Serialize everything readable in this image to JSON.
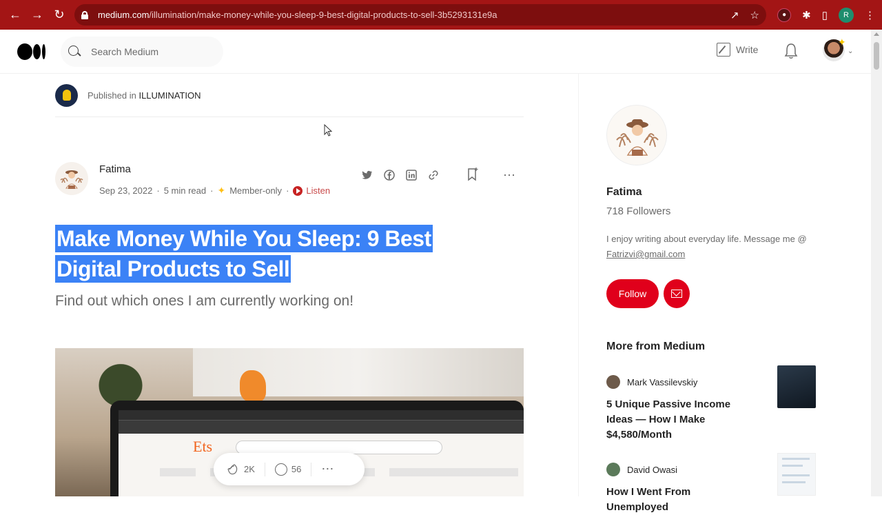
{
  "browser": {
    "url_host": "medium.com",
    "url_path": "/illumination/make-money-while-you-sleep-9-best-digital-products-to-sell-3b5293131e9a",
    "profile_initial": "R"
  },
  "header": {
    "search_placeholder": "Search Medium",
    "write_label": "Write"
  },
  "publication": {
    "prefix": "Published in",
    "name": "ILLUMINATION"
  },
  "article": {
    "author": "Fatima",
    "date": "Sep 23, 2022",
    "read_time": "5 min read",
    "member_label": "Member-only",
    "listen_label": "Listen",
    "title": "Make Money While You Sleep: 9 Best Digital Products to Sell",
    "subtitle": "Find out which ones I am currently working on!",
    "claps": "2K",
    "comments": "56"
  },
  "sidebar": {
    "author_name": "Fatima",
    "followers": "718 Followers",
    "bio_text": "I enjoy writing about everyday life. Message me @",
    "bio_email": "Fatrizvi@gmail.com",
    "follow_label": "Follow",
    "more_from_label": "More from Medium",
    "recommendations": [
      {
        "author": "Mark Vassilevskiy",
        "title": "5 Unique Passive Income Ideas — How I Make $4,580/Month"
      },
      {
        "author": "David Owasi",
        "title": "How I Went From Unemployed"
      }
    ]
  },
  "colors": {
    "browser_bar": "#a31515",
    "accent_red": "#e0001b",
    "selection": "#3b82f6"
  }
}
